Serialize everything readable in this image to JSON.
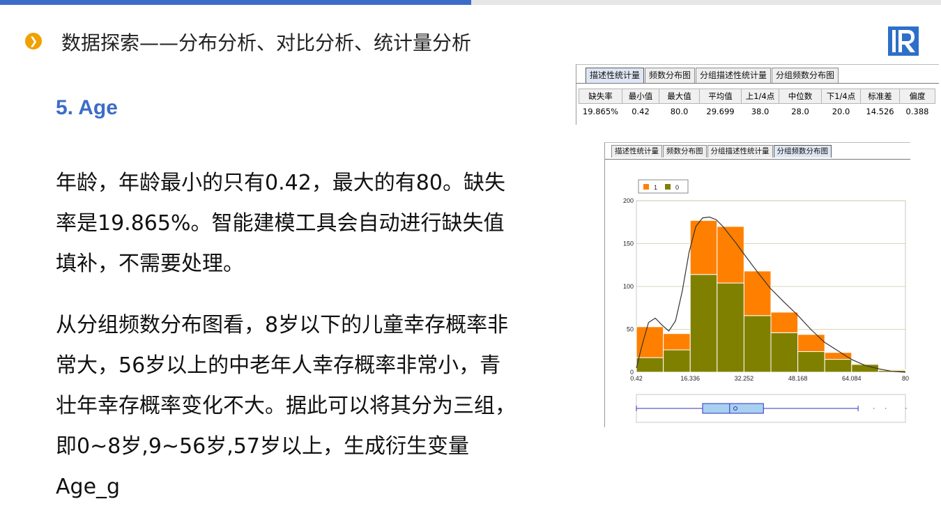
{
  "header": {
    "bullet": "❯",
    "title": "数据探索——分布分析、对比分析、统计量分析"
  },
  "section": {
    "title": "5. Age"
  },
  "paragraphs": {
    "p1": "年龄，年龄最小的只有0.42，最大的有80。缺失率是19.865%。智能建模工具会自动进行缺失值填补，不需要处理。",
    "p2": "从分组频数分布图看，8岁以下的儿童幸存概率非常大，56岁以上的中老年人幸存概率非常小，青壮年幸存概率变化不大。据此可以将其分为三组，即0~8岁,9~56岁,57岁以上，生成衍生变量Age_g"
  },
  "stats_panel": {
    "tabs": [
      "描述性统计量",
      "频数分布图",
      "分组描述性统计量",
      "分组频数分布图"
    ],
    "active_tab": 0,
    "headers": [
      "缺失率",
      "最小值",
      "最大值",
      "平均值",
      "上1/4点",
      "中位数",
      "下1/4点",
      "标准差",
      "偏度"
    ],
    "values": [
      "19.865%",
      "0.42",
      "80.0",
      "29.699",
      "38.0",
      "28.0",
      "20.0",
      "14.526",
      "0.388"
    ]
  },
  "chart_panel": {
    "tabs": [
      "描述性统计量",
      "频数分布图",
      "分组描述性统计量",
      "分组频数分布图"
    ],
    "active_tab": 3
  },
  "colors": {
    "accent": "#3d6cc8",
    "bullet": "#f0a000",
    "series_1": "#ff8000",
    "series_0": "#808000",
    "boxplot_fill": "#a8d0f0",
    "boxplot_line": "#3030c0"
  },
  "chart_data": {
    "type": "bar",
    "stacked": true,
    "legend": [
      "1",
      "0"
    ],
    "legend_position": "top-left",
    "x_ticks": [
      "0.42",
      "16.336",
      "32.252",
      "48.168",
      "64.084",
      "80"
    ],
    "y_ticks": [
      "0",
      "50",
      "100",
      "150",
      "200"
    ],
    "ylim": [
      0,
      200
    ],
    "xlim": [
      0.42,
      80
    ],
    "bins": [
      {
        "x0": 0.42,
        "x1": 8.38,
        "s0": 17,
        "s1": 36
      },
      {
        "x0": 8.38,
        "x1": 16.34,
        "s0": 26,
        "s1": 19
      },
      {
        "x0": 16.34,
        "x1": 24.29,
        "s0": 114,
        "s1": 63
      },
      {
        "x0": 24.29,
        "x1": 32.25,
        "s0": 104,
        "s1": 66
      },
      {
        "x0": 32.25,
        "x1": 40.21,
        "s0": 66,
        "s1": 52
      },
      {
        "x0": 40.21,
        "x1": 48.17,
        "s0": 46,
        "s1": 24
      },
      {
        "x0": 48.17,
        "x1": 56.13,
        "s0": 24,
        "s1": 20
      },
      {
        "x0": 56.13,
        "x1": 64.08,
        "s0": 15,
        "s1": 8
      },
      {
        "x0": 64.08,
        "x1": 72.04,
        "s0": 9,
        "s1": 1
      },
      {
        "x0": 72.04,
        "x1": 80.0,
        "s0": 2,
        "s1": 1
      }
    ],
    "density_curve": [
      [
        0.42,
        5
      ],
      [
        2,
        30
      ],
      [
        4,
        58
      ],
      [
        6,
        63
      ],
      [
        8,
        55
      ],
      [
        10,
        48
      ],
      [
        12,
        60
      ],
      [
        14,
        95
      ],
      [
        16,
        140
      ],
      [
        18,
        170
      ],
      [
        20,
        180
      ],
      [
        22,
        181
      ],
      [
        24,
        178
      ],
      [
        26,
        170
      ],
      [
        28,
        160
      ],
      [
        30,
        150
      ],
      [
        32,
        139
      ],
      [
        36,
        118
      ],
      [
        40,
        98
      ],
      [
        44,
        82
      ],
      [
        48,
        67
      ],
      [
        52,
        50
      ],
      [
        56,
        35
      ],
      [
        60,
        25
      ],
      [
        64,
        15
      ],
      [
        68,
        8
      ],
      [
        72,
        4
      ],
      [
        76,
        1
      ],
      [
        80,
        0
      ]
    ],
    "boxplot": {
      "min": 0.42,
      "q1": 20.0,
      "median": 28.0,
      "mean": 29.699,
      "q3": 38.0,
      "whisker_high": 66.0,
      "outliers": [
        70.5,
        74,
        80
      ]
    }
  }
}
